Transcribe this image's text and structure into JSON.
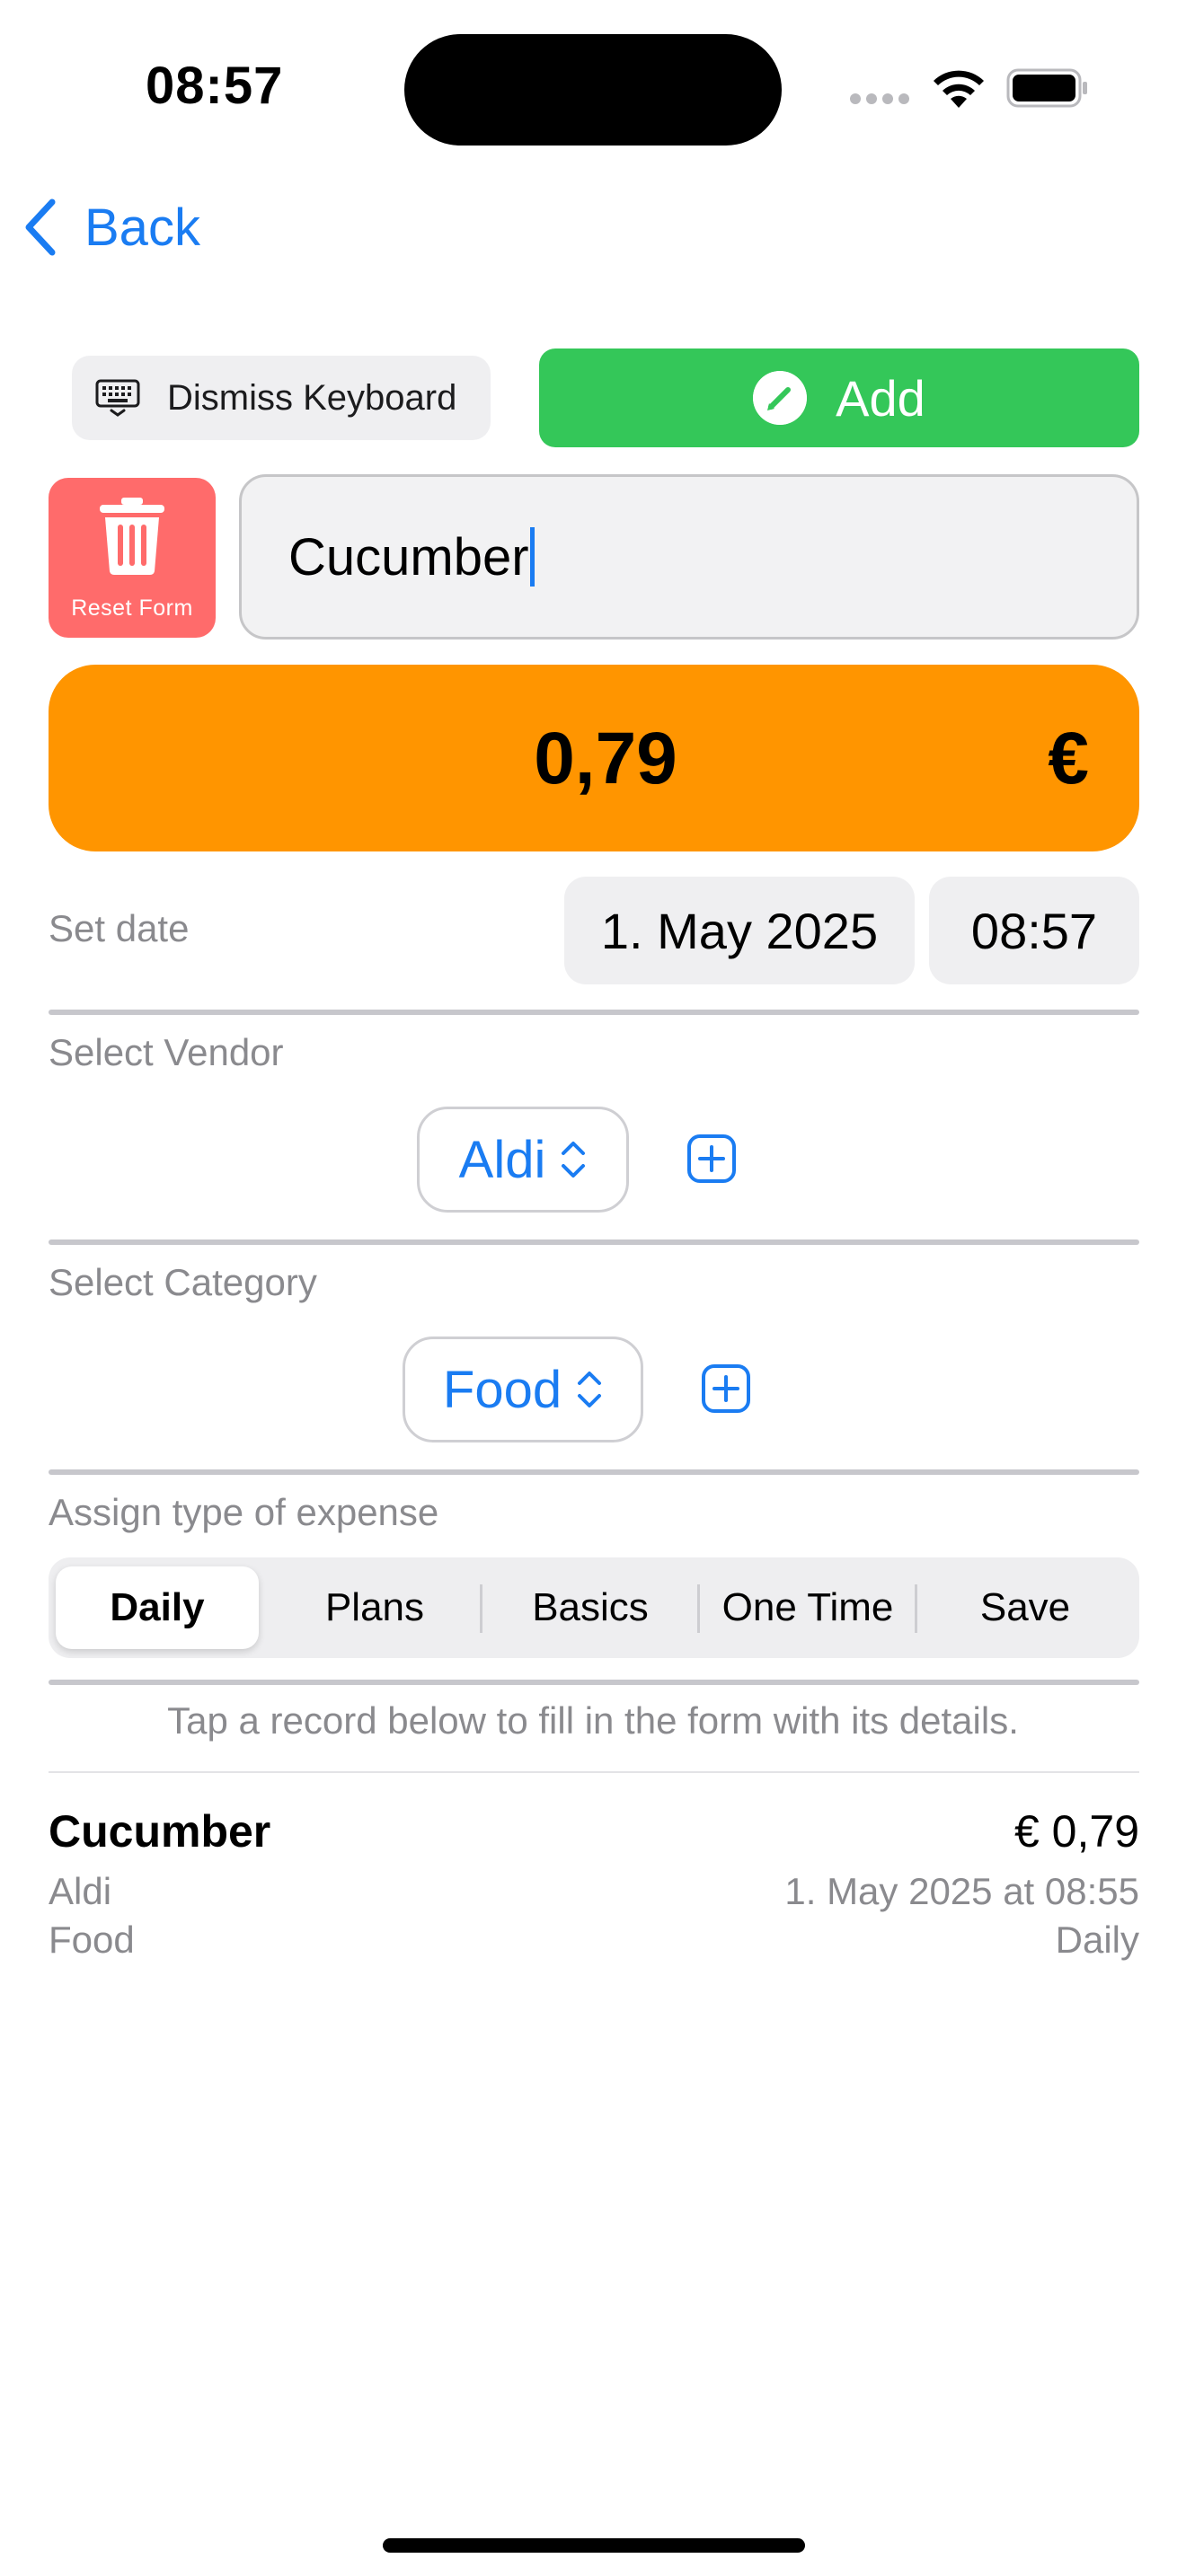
{
  "status_bar": {
    "time": "08:57"
  },
  "nav": {
    "back_label": "Back"
  },
  "toolbar": {
    "dismiss_label": "Dismiss Keyboard",
    "add_label": "Add"
  },
  "reset": {
    "label": "Reset Form"
  },
  "form": {
    "name_value": "Cucumber",
    "amount_value": "0,79",
    "currency_symbol": "€",
    "set_date_label": "Set date",
    "date_value": "1. May 2025",
    "time_value": "08:57",
    "vendor_label": "Select Vendor",
    "vendor_value": "Aldi",
    "category_label": "Select Category",
    "category_value": "Food",
    "type_label": "Assign type of expense",
    "types": [
      "Daily",
      "Plans",
      "Basics",
      "One Time",
      "Save"
    ],
    "selected_type": "Daily"
  },
  "records": {
    "hint": "Tap a record below to fill in the form with its details.",
    "items": [
      {
        "name": "Cucumber",
        "amount": "€ 0,79",
        "vendor": "Aldi",
        "datetime": "1. May 2025 at 08:55",
        "category": "Food",
        "type": "Daily"
      }
    ]
  },
  "colors": {
    "accent": "#1a7cf2",
    "add_green": "#34c759",
    "reset_red": "#ff6b6b",
    "amount_orange": "#ff9500"
  }
}
